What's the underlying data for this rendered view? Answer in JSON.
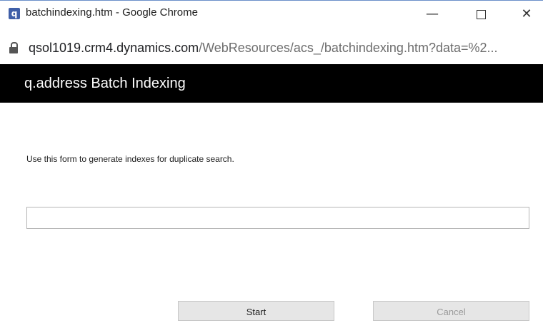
{
  "window": {
    "title": "batchindexing.htm - Google Chrome",
    "app_icon_letter": "q",
    "controls": {
      "minimize": "—",
      "close": "✕"
    }
  },
  "address_bar": {
    "host": "qsol1019.crm4.dynamics.com",
    "path": "/WebResources/acs_/batchindexing.htm?data=%2..."
  },
  "header": {
    "title": "q.address Batch Indexing"
  },
  "main": {
    "instruction": "Use this form to generate indexes for duplicate search.",
    "progress": {
      "value": 0
    },
    "buttons": {
      "start_label": "Start",
      "cancel_label": "Cancel"
    }
  },
  "colors": {
    "header_bg": "#000000",
    "header_text": "#ffffff",
    "button_bg": "#e6e6e6",
    "disabled_text": "#9a9a9a"
  },
  "icons": [
    "app-icon",
    "lock-icon"
  ]
}
